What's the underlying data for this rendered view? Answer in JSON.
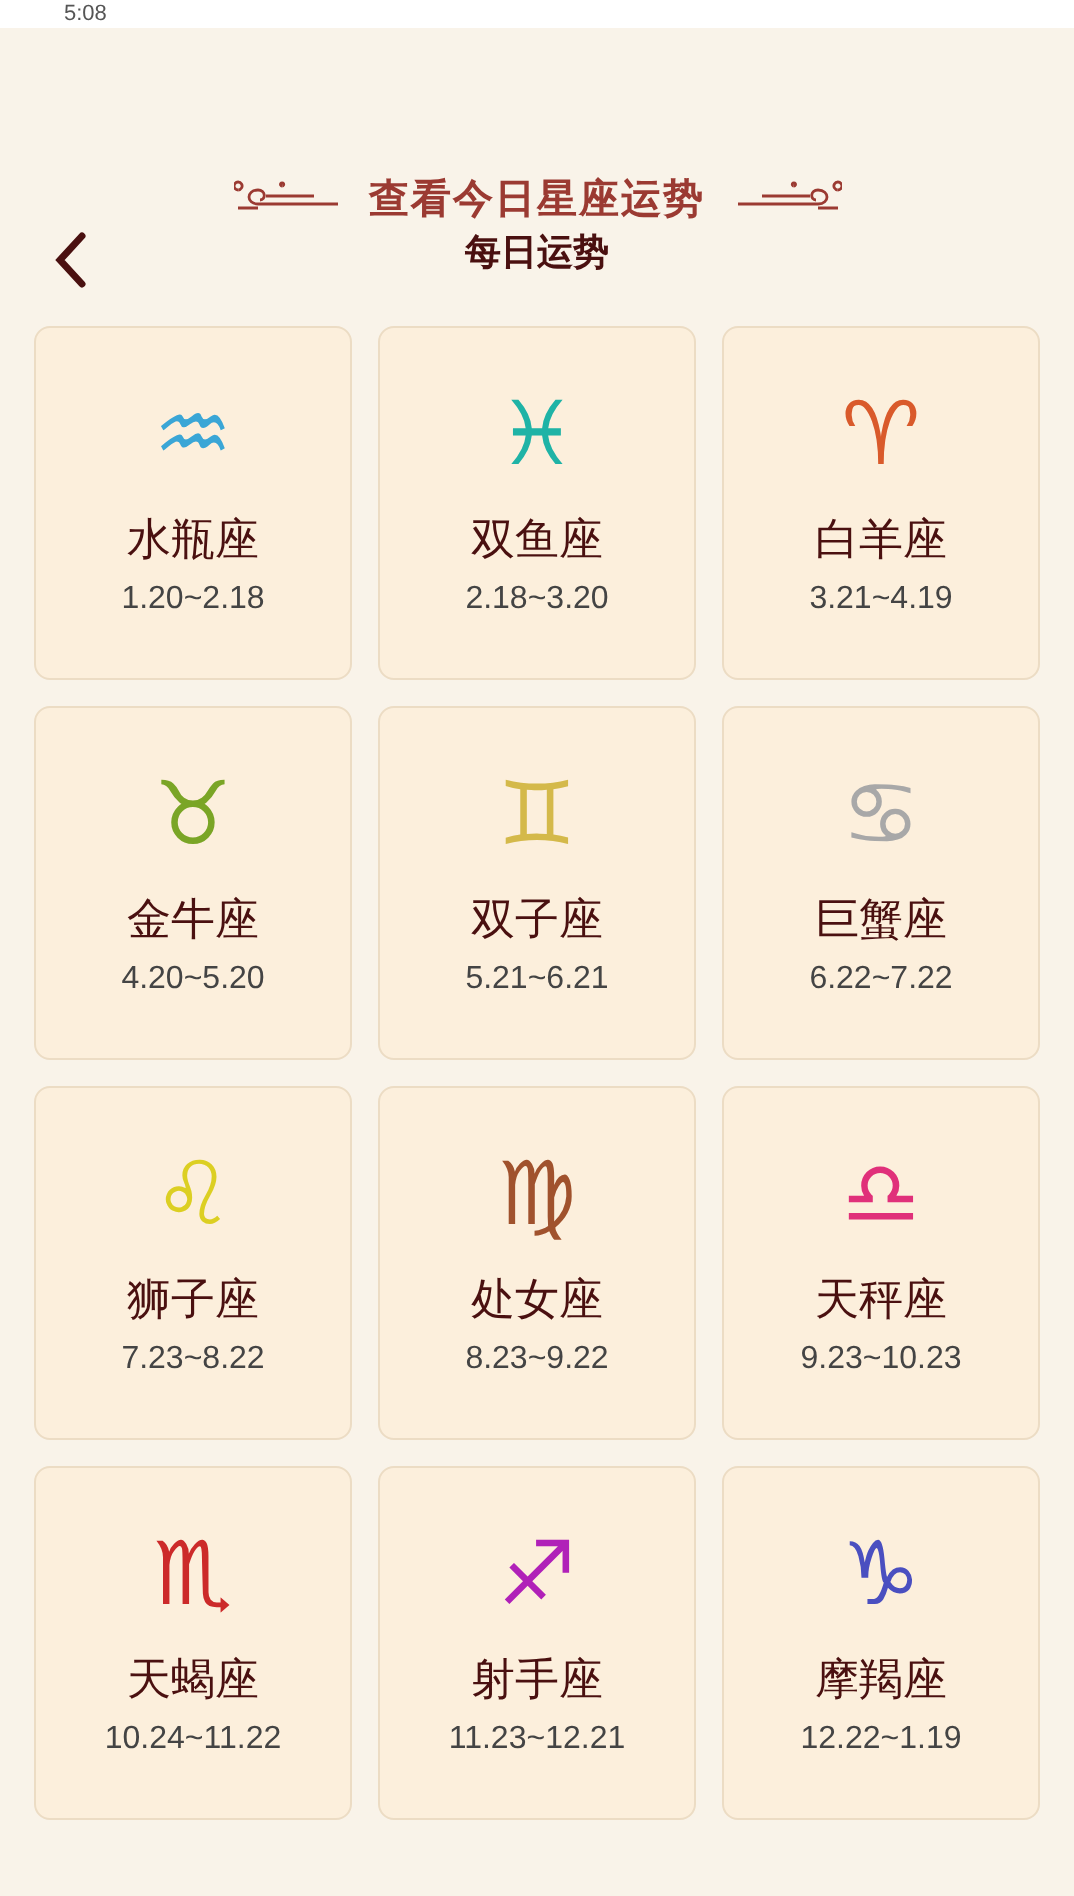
{
  "status_bar": {
    "time": "5:08"
  },
  "header": {
    "title": "查看今日星座运势",
    "subtitle": "每日运势"
  },
  "signs": [
    {
      "symbol": "♒",
      "color": "#3aa6d6",
      "name": "水瓶座",
      "dates": "1.20~2.18"
    },
    {
      "symbol": "♓",
      "color": "#1fb3a6",
      "name": "双鱼座",
      "dates": "2.18~3.20"
    },
    {
      "symbol": "♈",
      "color": "#d95a2b",
      "name": "白羊座",
      "dates": "3.21~4.19"
    },
    {
      "symbol": "♉",
      "color": "#7aa526",
      "name": "金牛座",
      "dates": "4.20~5.20"
    },
    {
      "symbol": "♊",
      "color": "#d4b94a",
      "name": "双子座",
      "dates": "5.21~6.21"
    },
    {
      "symbol": "♋",
      "color": "#a8a8a8",
      "name": "巨蟹座",
      "dates": "6.22~7.22"
    },
    {
      "symbol": "♌",
      "color": "#dccf22",
      "name": "狮子座",
      "dates": "7.23~8.22"
    },
    {
      "symbol": "♍",
      "color": "#a0522d",
      "name": "处女座",
      "dates": "8.23~9.22"
    },
    {
      "symbol": "♎",
      "color": "#e0307a",
      "name": "天秤座",
      "dates": "9.23~10.23"
    },
    {
      "symbol": "♏",
      "color": "#cc2a2a",
      "name": "天蝎座",
      "dates": "10.24~11.22"
    },
    {
      "symbol": "♐",
      "color": "#b021b8",
      "name": "射手座",
      "dates": "11.23~12.21"
    },
    {
      "symbol": "♑",
      "color": "#4a4fc0",
      "name": "摩羯座",
      "dates": "12.22~1.19"
    }
  ]
}
